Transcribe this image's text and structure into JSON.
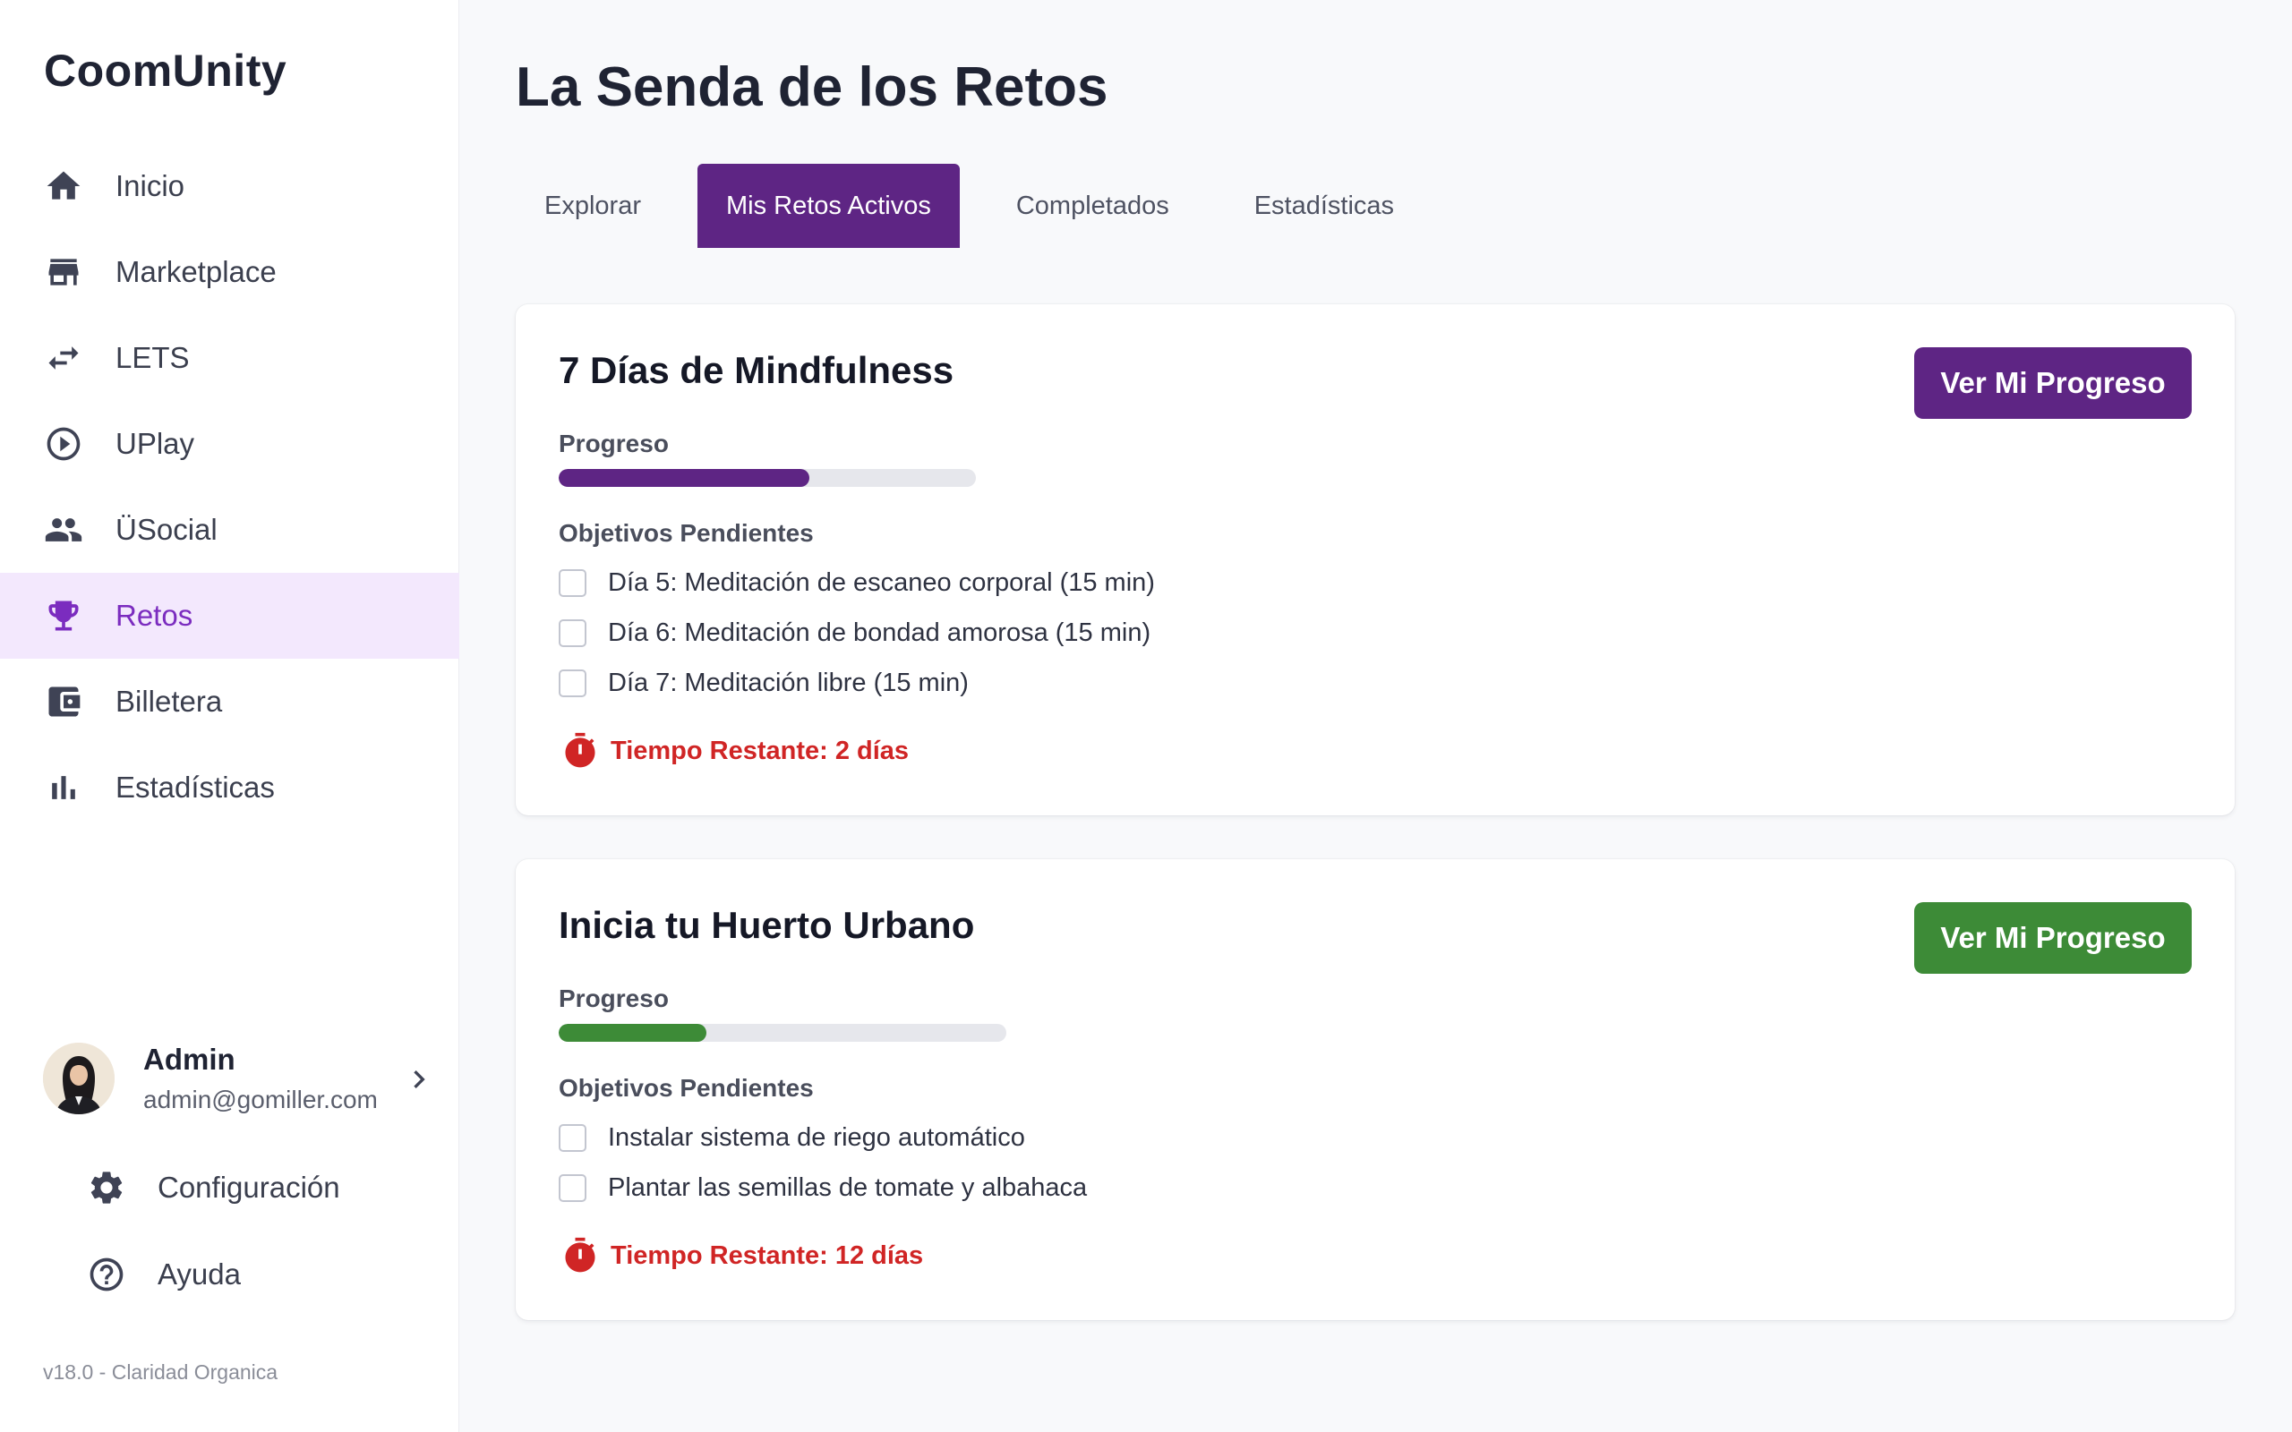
{
  "brand": "CoomUnity",
  "nav": [
    {
      "label": "Inicio",
      "icon": "home-icon"
    },
    {
      "label": "Marketplace",
      "icon": "store-icon"
    },
    {
      "label": "LETS",
      "icon": "swap-icon"
    },
    {
      "label": "UPlay",
      "icon": "play-circle-icon"
    },
    {
      "label": "ÜSocial",
      "icon": "people-icon"
    },
    {
      "label": "Retos",
      "icon": "trophy-icon",
      "active": true
    },
    {
      "label": "Billetera",
      "icon": "wallet-icon"
    },
    {
      "label": "Estadísticas",
      "icon": "bar-chart-icon"
    }
  ],
  "user": {
    "name": "Admin",
    "email": "admin@gomiller.com"
  },
  "footer_links": {
    "settings": "Configuración",
    "help": "Ayuda"
  },
  "version": "v18.0 - Claridad Organica",
  "page_title": "La Senda de los Retos",
  "tabs": [
    {
      "label": "Explorar"
    },
    {
      "label": "Mis Retos Activos",
      "active": true
    },
    {
      "label": "Completados"
    },
    {
      "label": "Estadísticas"
    }
  ],
  "challenges": [
    {
      "title": "7 Días de Mindfulness",
      "button": "Ver Mi Progreso",
      "accent": "#5e2584",
      "progress_label": "Progreso",
      "progress": 0.6,
      "objectives_label": "Objetivos Pendientes",
      "objectives": [
        "Día 5: Meditación de escaneo corporal (15 min)",
        "Día 6: Meditación de bondad amorosa (15 min)",
        "Día 7: Meditación libre (15 min)"
      ],
      "time_remaining": "Tiempo Restante: 2 días"
    },
    {
      "title": "Inicia tu Huerto Urbano",
      "button": "Ver Mi Progreso",
      "accent": "#3d8b37",
      "progress_label": "Progreso",
      "progress": 0.33,
      "objectives_label": "Objetivos Pendientes",
      "objectives": [
        "Instalar sistema de riego automático",
        "Plantar las semillas de tomate y albahaca"
      ],
      "time_remaining": "Tiempo Restante: 12 días"
    }
  ],
  "colors": {
    "primary": "#5e2584",
    "success": "#3d8b37",
    "danger": "#d02525",
    "active_bg": "#f3e8fd",
    "active_fg": "#7b2cbf"
  }
}
